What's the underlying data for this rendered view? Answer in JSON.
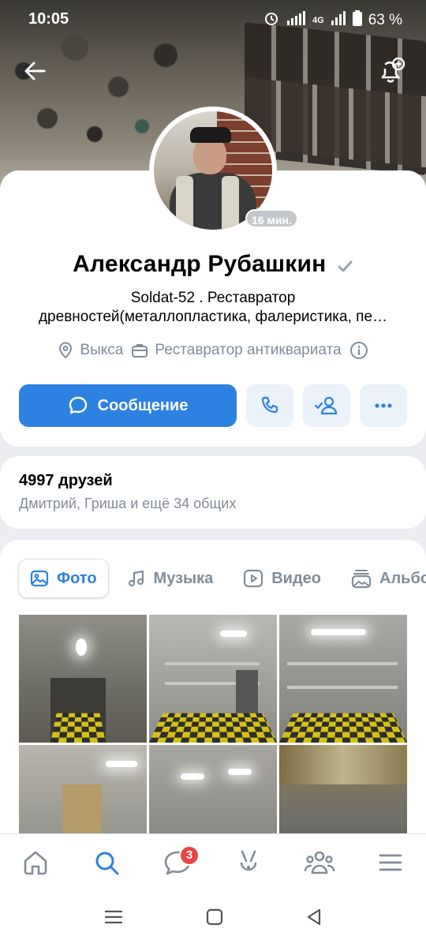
{
  "status_bar": {
    "time": "10:05",
    "network": "4G",
    "battery": "63 %"
  },
  "profile": {
    "name": "Александр Рубашкин",
    "online_ago": "16 мин.",
    "status_line1": "Soldat-52 . Реставратор",
    "status_line2": "древностей(металлопластика, фалеристика, пе…",
    "city": "Выкса",
    "occupation": "Реставратор антиквариата"
  },
  "actions": {
    "message_label": "Сообщение"
  },
  "friends": {
    "title": "4997 друзей",
    "subtitle": "Дмитрий, Гриша и ещё 34 общих"
  },
  "media_tabs": [
    {
      "label": "Фото",
      "icon": "image-icon",
      "active": true
    },
    {
      "label": "Музыка",
      "icon": "music-note-icon"
    },
    {
      "label": "Видео",
      "icon": "video-play-icon"
    },
    {
      "label": "Альбомы",
      "icon": "album-icon"
    }
  ],
  "bottom_nav": {
    "items": [
      "home-icon",
      "search-icon",
      "messages-icon",
      "clips-icon",
      "friends-icon",
      "menu-icon"
    ],
    "messages_badge": "3",
    "active": "search-icon"
  },
  "colors": {
    "accent": "#2d81e0",
    "secondary_text": "#818c99",
    "badge": "#e64646",
    "card_bg": "#ffffff",
    "page_bg": "#ebedf0"
  }
}
